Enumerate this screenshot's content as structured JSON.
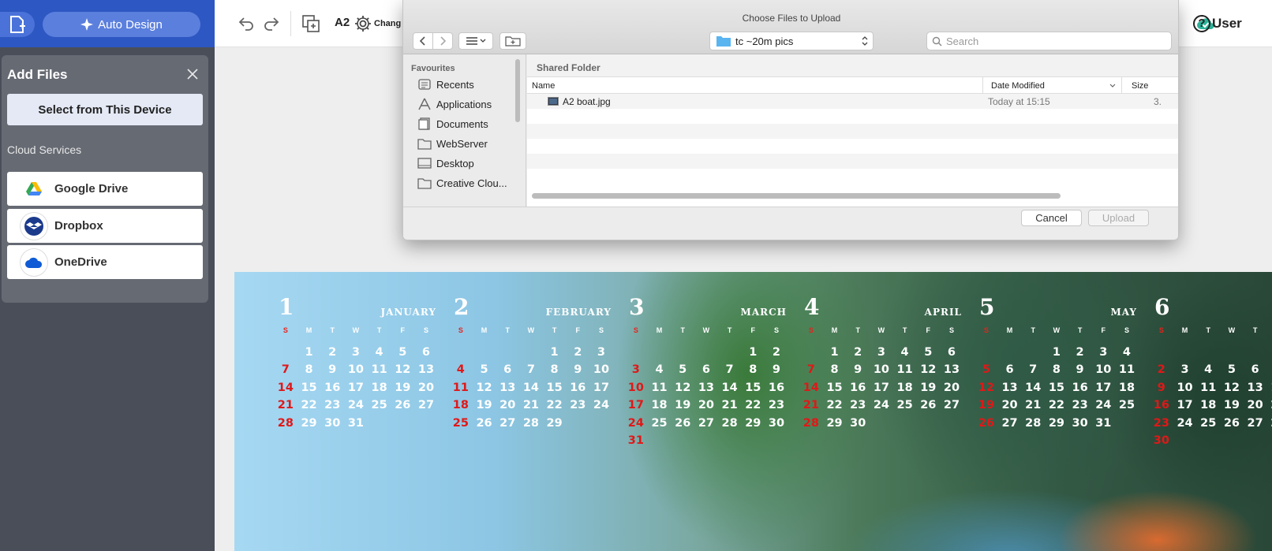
{
  "app": {
    "auto_design_label": "Auto Design",
    "size_label": "A2",
    "change_label": "Chang",
    "user_label": "User"
  },
  "add_files": {
    "title": "Add Files",
    "select_device_label": "Select from This Device",
    "cloud_services_label": "Cloud Services",
    "services": [
      {
        "label": "Google Drive",
        "icon": "google-drive-icon"
      },
      {
        "label": "Dropbox",
        "icon": "dropbox-icon"
      },
      {
        "label": "OneDrive",
        "icon": "onedrive-icon"
      }
    ]
  },
  "dialog": {
    "title": "Choose Files to Upload",
    "folder": "tc ~20m pics",
    "search_placeholder": "Search",
    "favourites_header": "Favourites",
    "favourites": [
      "Recents",
      "Applications",
      "Documents",
      "WebServer",
      "Desktop",
      "Creative Clou..."
    ],
    "shared_folder_label": "Shared Folder",
    "columns": {
      "name": "Name",
      "date_modified": "Date Modified",
      "size": "Size"
    },
    "files": [
      {
        "name": "A2 boat.jpg",
        "date_modified": "Today at 15:15",
        "size": "3."
      }
    ],
    "cancel_label": "Cancel",
    "upload_label": "Upload"
  },
  "calendar": {
    "weekday_headers": [
      "S",
      "M",
      "T",
      "W",
      "T",
      "F",
      "S"
    ],
    "months": [
      {
        "num": "1",
        "name": "January",
        "start": 1,
        "days": 31
      },
      {
        "num": "2",
        "name": "February",
        "start": 4,
        "days": 29
      },
      {
        "num": "3",
        "name": "March",
        "start": 5,
        "days": 31
      },
      {
        "num": "4",
        "name": "April",
        "start": 1,
        "days": 30
      },
      {
        "num": "5",
        "name": "May",
        "start": 3,
        "days": 31
      },
      {
        "num": "6",
        "name": "",
        "start": 6,
        "days": 30
      }
    ]
  },
  "colors": {
    "brand_blue": "#2d57c2",
    "sunday_red": "#e01818",
    "cloud_ok_green": "#2bb39a"
  }
}
